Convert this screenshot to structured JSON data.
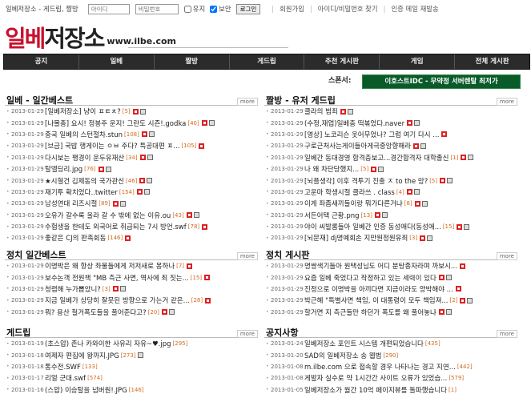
{
  "topbar": {
    "title": "일베저장소 - 게드립, 짤방",
    "id_placeholder": "아이디",
    "pw_placeholder": "비밀번호",
    "keep_label": "유지",
    "secure_label": "보안",
    "login_label": "로그인",
    "signup": "회원가입",
    "find": "아이디/비밀번호 찾기",
    "resend": "인증 메일 재발송"
  },
  "logo": {
    "text1": "일베",
    "text2": "저장소",
    "url": "www.ilbe.com"
  },
  "nav": [
    "공지",
    "일베",
    "짤방",
    "게드립",
    "추천 게시판",
    "게임",
    "전체 게시판"
  ],
  "sponsor": {
    "label": "스폰서:",
    "banner": "이호스트IDC - 무약정 서버렌탈 최저가"
  },
  "more": "more",
  "sections": [
    {
      "title": "일베 - 일간베스트",
      "rows": [
        {
          "date": "2013-01-29",
          "text": "[일베저장소] 냥이 ㅍㅌㅊ?",
          "count": "[5]",
          "n": 1,
          "p": 1
        },
        {
          "date": "2013-01-29",
          "text": "[나몰총] 요시! 정봉주 운지! 그란도 시즌!.godka",
          "count": "[40]",
          "n": 1,
          "p": 1
        },
        {
          "date": "2013-01-29",
          "text": "중국 일베의 스턴절차.stun",
          "count": "[108]",
          "n": 1,
          "p": 1
        },
        {
          "date": "2013-01-29",
          "text": "[브금] 국밥 행게이는 ㅇㅂ 주다? 특공대편 ㅍ...",
          "count": "[105]",
          "n": 1,
          "p": 0
        },
        {
          "date": "2013-01-29",
          "text": "다시보는 팽경이 운두유재산",
          "count": "[34]",
          "n": 1,
          "p": 1
        },
        {
          "date": "2013-01-29",
          "text": "탈엘딩리.jpg",
          "count": "[76]",
          "n": 1,
          "p": 1
        },
        {
          "date": "2013-01-29",
          "text": "★시혈건 김제동의 국가관신",
          "count": "[46]",
          "n": 1,
          "p": 1
        },
        {
          "date": "2013-01-29",
          "text": "재기투 확치었다..twitter",
          "count": "[154]",
          "n": 1,
          "p": 1
        },
        {
          "date": "2013-01-29",
          "text": "남성연대 리즈시절",
          "count": "[89]",
          "n": 1,
          "p": 1
        },
        {
          "date": "2013-01-29",
          "text": "오유가 갈수록 올라 갈 수 밖에 없는 이유.ou",
          "count": "[43]",
          "n": 1,
          "p": 1
        },
        {
          "date": "2013-01-29",
          "text": "수험생을 한테도 외국어로 취급되는 7시 방언.swf",
          "count": "[78]",
          "n": 1,
          "p": 0
        },
        {
          "date": "2013-01-29",
          "text": "좋같은 CJ의 판촉회동",
          "count": "[146]",
          "n": 1,
          "p": 0
        }
      ]
    },
    {
      "title": "짤방 - 유저 게드립",
      "rows": [
        {
          "date": "2013-01-29",
          "text": "클라의 범죄",
          "count": "",
          "n": 1,
          "p": 1
        },
        {
          "date": "2013-01-29",
          "text": "(수정,재업)일베충 떡볶었다.naver",
          "count": "",
          "n": 1,
          "p": 1
        },
        {
          "date": "2013-01-29",
          "text": "[영상] 노코리슨 옷어무었나? 그럼 여기 다시 ...",
          "count": "",
          "n": 1,
          "p": 0
        },
        {
          "date": "2013-01-29",
          "text": "구로근처사는게이들아게극중앙향해라",
          "count": "",
          "n": 1,
          "p": 1
        },
        {
          "date": "2013-01-29",
          "text": "일베간 동대경영 합격충보고...경간함격자 대학졸신",
          "count": "[1]",
          "n": 1,
          "p": 1
        },
        {
          "date": "2013-01-29",
          "text": "나 왜 차단당했지...",
          "count": "[5]",
          "n": 1,
          "p": 1
        },
        {
          "date": "2013-01-29",
          "text": "[뇌플생각] 이후 격투기 진출 ㅈ to the 망?",
          "count": "[5]",
          "n": 1,
          "p": 1
        },
        {
          "date": "2013-01-29",
          "text": "고운마 학생시절 클라쓰 . class",
          "count": "[4]",
          "n": 1,
          "p": 1
        },
        {
          "date": "2013-01-29",
          "text": "이게 좌좀새끼들이랑 뭐가다른거냐",
          "count": "[8]",
          "n": 1,
          "p": 1
        },
        {
          "date": "2013-01-29",
          "text": "서든어택 근황.png",
          "count": "[13]",
          "n": 1,
          "p": 1
        },
        {
          "date": "2013-01-29",
          "text": "야이 씨발롬들아 일베간 인증 동성애다(동성애...",
          "count": "[15]",
          "n": 1,
          "p": 1
        },
        {
          "date": "2013-01-29",
          "text": "[뇌문재] dj명예회손 지만원정원유죄",
          "count": "[3]",
          "n": 1,
          "p": 1
        }
      ]
    },
    {
      "title": "정치 일간베스트",
      "rows": [
        {
          "date": "2013-01-29",
          "text": "이명박은 왜 항상 좌물들에게 저저새로 몽하나",
          "count": "[7]",
          "n": 1,
          "p": 0
        },
        {
          "date": "2013-01-29",
          "text": "보수논객 전원책 \"MB 측근 사면, 역사에 죄 짓는...",
          "count": "[15]",
          "n": 1,
          "p": 0
        },
        {
          "date": "2013-01-29",
          "text": "청렴해 누가뽑았니?",
          "count": "[3]",
          "n": 1,
          "p": 1
        },
        {
          "date": "2013-01-29",
          "text": "지금 일베가 상당히 잘못된 방향으로 가는거 같은...",
          "count": "[28]",
          "n": 1,
          "p": 0
        },
        {
          "date": "2013-01-29",
          "text": "뭐? 용산 철거폭도들을 풀어준다고?",
          "count": "[20]",
          "n": 1,
          "p": 1
        }
      ]
    },
    {
      "title": "정치 게시판",
      "rows": [
        {
          "date": "2013-01-29",
          "text": "명쌍색기들아 원택성님도 어디 분탕종자라며 까보시...",
          "count": "",
          "n": 1,
          "p": 0
        },
        {
          "date": "2013-01-29",
          "text": "요즘 일베 죽었다고 작정하고 있는 세력이 있다",
          "count": "",
          "n": 1,
          "p": 1
        },
        {
          "date": "2013-01-29",
          "text": "진정으로 이명박을 아끼다면 지금이라도 양박해야 ...",
          "count": "",
          "n": 1,
          "p": 0
        },
        {
          "date": "2013-01-29",
          "text": "박근혜 \"특별사면 책임, 이 대통령이 모두 책임져...",
          "count": "[2]",
          "n": 1,
          "p": 1
        },
        {
          "date": "2013-01-29",
          "text": "할거면 지 측근들만 하던가 폭도를 왜 풀어놓냐",
          "count": "",
          "n": 1,
          "p": 1
        }
      ]
    },
    {
      "title": "게드립",
      "rows": [
        {
          "date": "2013-01-19",
          "text": "(초스압) 존나 카와이한 사유리 자유~♥.jpg",
          "count": "[295]",
          "n": 0,
          "p": 0
        },
        {
          "date": "2013-01-18",
          "text": "여제자 편집에 왕까지.JPG",
          "count": "[273]",
          "n": 0,
          "p": 1
        },
        {
          "date": "2013-01-18",
          "text": "통수전.SWF",
          "count": "[133]",
          "n": 0,
          "p": 0
        },
        {
          "date": "2013-01-17",
          "text": "리얼 군대.swf",
          "count": "[574]",
          "n": 0,
          "p": 0
        },
        {
          "date": "2013-01-16",
          "text": "(스압) 이승탈을 넘버원!.JPG",
          "count": "[146]",
          "n": 0,
          "p": 0
        }
      ]
    },
    {
      "title": "공지사항",
      "rows": [
        {
          "date": "2013-01-24",
          "text": "일베저장소 포인트 시스템 개편되었습니다",
          "count": "[435]",
          "n": 0,
          "p": 0
        },
        {
          "date": "2013-01-20",
          "text": "SAD의 일베저장소 송 웹범",
          "count": "[290]",
          "n": 0,
          "p": 0
        },
        {
          "date": "2013-01-08",
          "text": "m.ilbe.com 으로 접속할 경우 나타나는 경고 지연...",
          "count": "[442]",
          "n": 0,
          "p": 0
        },
        {
          "date": "2013-01-08",
          "text": "게발자 실수로 약 1시간간 사이트 오류가 있었습...",
          "count": "[579]",
          "n": 0,
          "p": 0
        },
        {
          "date": "2013-01-05",
          "text": "일베저장소가 월간 10억 페이지뷰를 돌파했습니다",
          "count": "[1]",
          "n": 0,
          "p": 0
        }
      ]
    }
  ]
}
